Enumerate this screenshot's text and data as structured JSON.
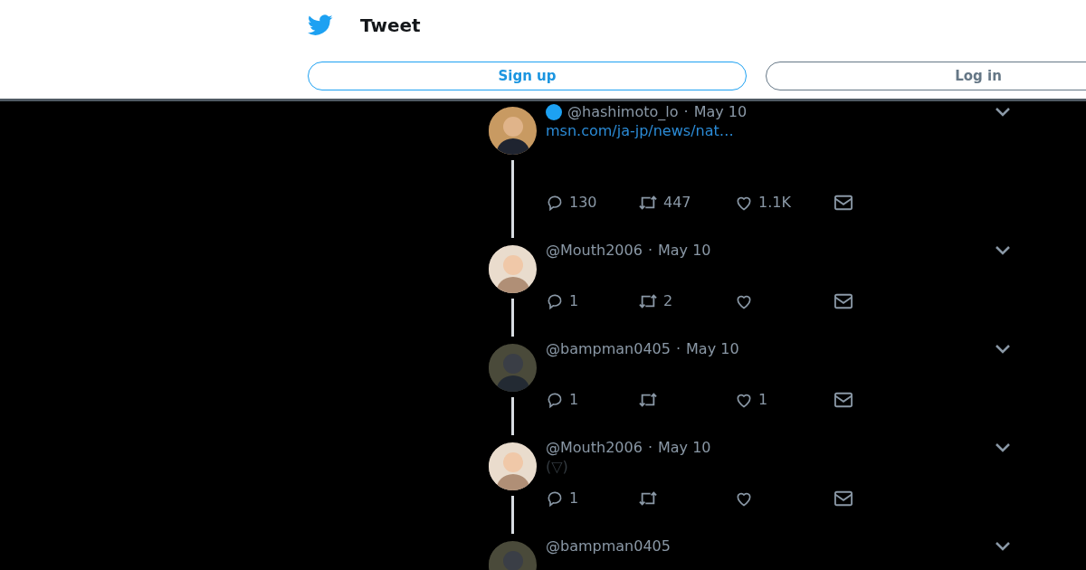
{
  "header": {
    "title": "Tweet",
    "buttons": [
      {
        "label": "Sign up",
        "kind": "primary"
      },
      {
        "label": "Log in",
        "kind": "secondary"
      }
    ]
  },
  "tweets": [
    {
      "handle": "@hashimoto_lo",
      "separator": "·",
      "date": "May 10",
      "verified": true,
      "link": "msn.com/ja-jp/news/nat…",
      "replies": "130",
      "retweets": "447",
      "likes": "1.1K"
    },
    {
      "handle": "@Mouth2006",
      "separator": "·",
      "date": "May 10",
      "verified": false,
      "replies": "1",
      "retweets": "2"
    },
    {
      "handle": "@bampman0405",
      "separator": "·",
      "date": "May 10",
      "verified": false,
      "replies": "1",
      "likes": "1"
    },
    {
      "handle": "@Mouth2006",
      "separator": "·",
      "date": "May 10",
      "verified": false,
      "text": "(▽)",
      "replies": "1"
    },
    {
      "handle": "@bampman0405",
      "verified": false
    }
  ]
}
